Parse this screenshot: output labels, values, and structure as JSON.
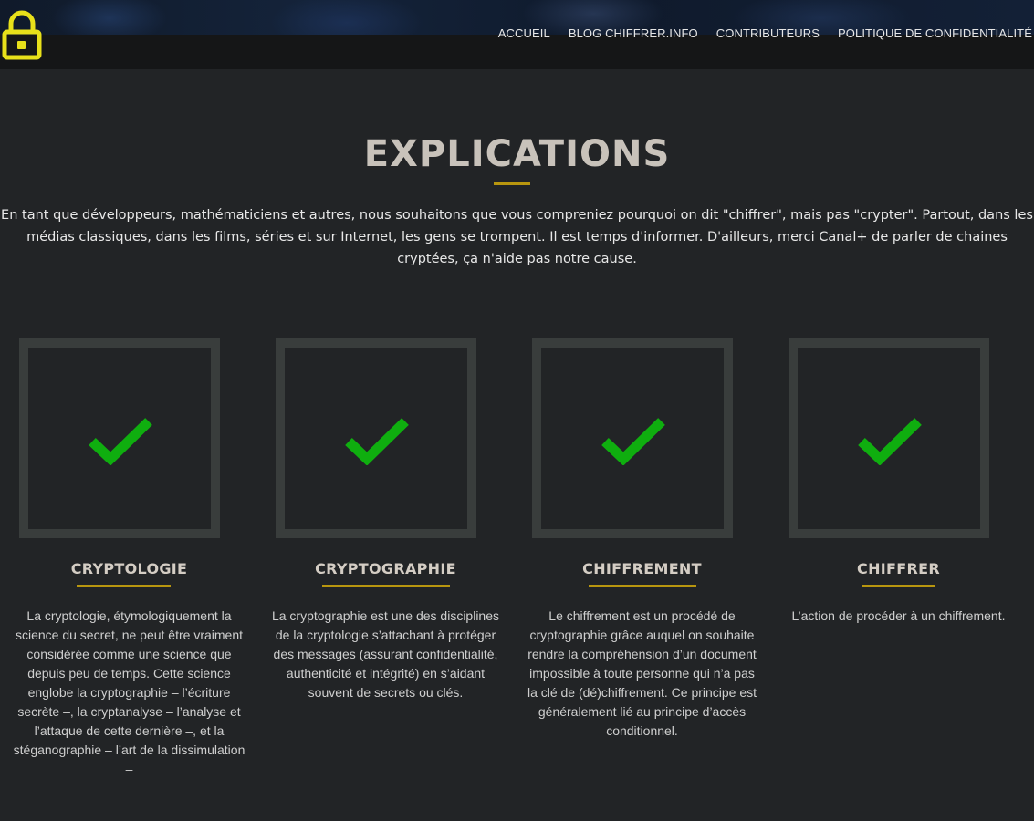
{
  "nav": {
    "items": [
      {
        "label": "ACCUEIL"
      },
      {
        "label": "BLOG CHIFFRER.INFO"
      },
      {
        "label": "CONTRIBUTEURS"
      },
      {
        "label": "POLITIQUE DE CONFIDENTIALITÉ"
      }
    ]
  },
  "logo": {
    "icon": "lock-icon",
    "color": "#e8e01a"
  },
  "section": {
    "title": "EXPLICATIONS",
    "intro": "En tant que développeurs, mathématiciens et autres, nous souhaitons que vous compreniez pourquoi on dit \"chiffrer\", mais pas \"crypter\". Partout, dans les médias classiques, dans les films, séries et sur Internet, les gens se trompent. Il est temps d'informer. D'ailleurs, merci Canal+ de parler de chaines cryptées, ça n'aide pas notre cause.",
    "accent_color": "#b8960f"
  },
  "cards": [
    {
      "icon": "check-icon",
      "title": "CRYPTOLOGIE",
      "text": "La cryptologie, étymologiquement la science du secret, ne peut être vraiment considérée comme une science que depuis peu de temps. Cette science englobe la cryptographie – l’écriture secrète –, la cryptanalyse – l’analyse et l’attaque de cette dernière –, et la stéganographie – l’art de la dissimulation –"
    },
    {
      "icon": "check-icon",
      "title": "CRYPTOGRAPHIE",
      "text": "La cryptographie est une des disciplines de la cryptologie s’attachant à protéger des messages (assurant confidentialité, authenticité et intégrité) en s’aidant souvent de secrets ou clés."
    },
    {
      "icon": "check-icon",
      "title": "CHIFFREMENT",
      "text": "Le chiffrement est un procédé de cryptographie grâce auquel on souhaite rendre la compréhension d’un document impossible à toute personne qui n’a pas la clé de (dé)chiffrement. Ce principe est généralement lié au principe d’accès conditionnel."
    },
    {
      "icon": "check-icon",
      "title": "CHIFFRER",
      "text": "L’action de procéder à un chiffrement."
    }
  ],
  "colors": {
    "check": "#0fae0f",
    "card_border": "#393d3c",
    "background": "#222426"
  }
}
